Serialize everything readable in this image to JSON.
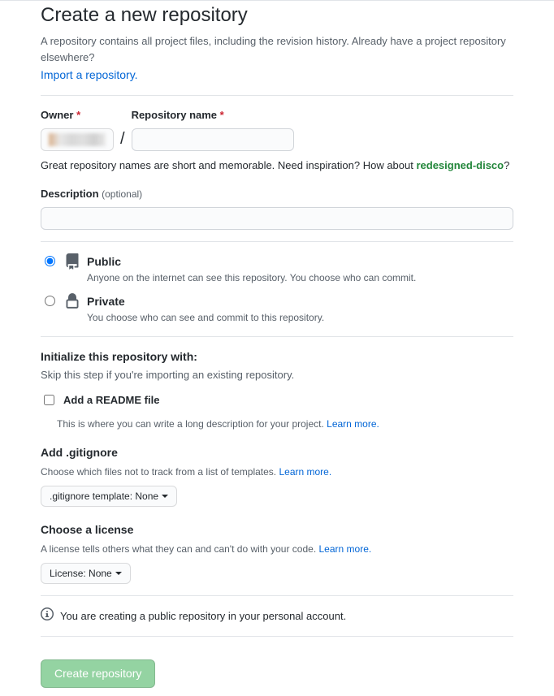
{
  "header": {
    "title": "Create a new repository",
    "subhead": "A repository contains all project files, including the revision history. Already have a project repository elsewhere?",
    "import_link": "Import a repository."
  },
  "owner": {
    "label": "Owner",
    "separator": "/"
  },
  "repo_name": {
    "label": "Repository name"
  },
  "hint": {
    "prefix": "Great repository names are short and memorable. Need inspiration? How about ",
    "suggestion": "redesigned-disco",
    "suffix": "?"
  },
  "description": {
    "label": "Description",
    "optional": "(optional)"
  },
  "visibility": {
    "public": {
      "title": "Public",
      "desc": "Anyone on the internet can see this repository. You choose who can commit."
    },
    "private": {
      "title": "Private",
      "desc": "You choose who can see and commit to this repository."
    }
  },
  "init": {
    "title": "Initialize this repository with:",
    "skip": "Skip this step if you're importing an existing repository."
  },
  "readme": {
    "label": "Add a README file",
    "desc": "This is where you can write a long description for your project. ",
    "learn": "Learn more."
  },
  "gitignore": {
    "title": "Add .gitignore",
    "desc": "Choose which files not to track from a list of templates. ",
    "learn": "Learn more.",
    "button": ".gitignore template: None"
  },
  "license": {
    "title": "Choose a license",
    "desc": "A license tells others what they can and can't do with your code. ",
    "learn": "Learn more.",
    "button": "License: None"
  },
  "info": {
    "text": "You are creating a public repository in your personal account."
  },
  "submit": {
    "label": "Create repository"
  }
}
